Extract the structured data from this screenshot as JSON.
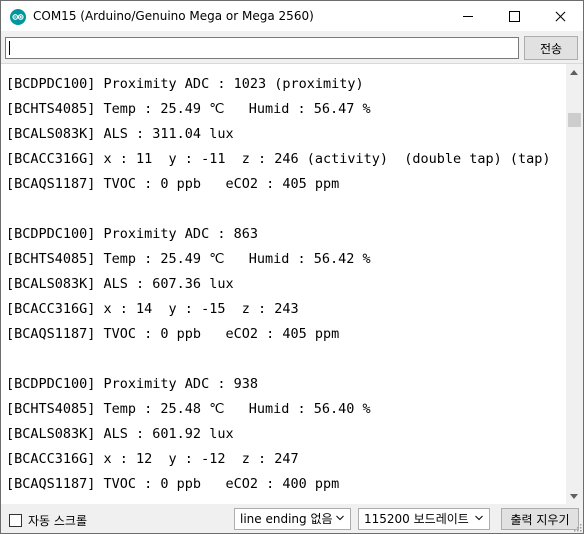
{
  "window": {
    "title": "COM15 (Arduino/Genuino Mega or Mega 2560)"
  },
  "input": {
    "value": "",
    "placeholder": "",
    "send_label": "전송"
  },
  "output": {
    "lines": [
      "[BCDPDC100] Proximity ADC : 1023 (proximity)",
      "[BCHTS4085] Temp : 25.49 ℃   Humid : 56.47 %",
      "[BCALS083K] ALS : 311.04 lux",
      "[BCACC316G] x : 11  y : -11  z : 246 (activity)  (double tap) (tap)",
      "[BCAQS1187] TVOC : 0 ppb   eCO2 : 405 ppm",
      "",
      "[BCDPDC100] Proximity ADC : 863",
      "[BCHTS4085] Temp : 25.49 ℃   Humid : 56.42 %",
      "[BCALS083K] ALS : 607.36 lux",
      "[BCACC316G] x : 14  y : -15  z : 243",
      "[BCAQS1187] TVOC : 0 ppb   eCO2 : 405 ppm",
      "",
      "[BCDPDC100] Proximity ADC : 938",
      "[BCHTS4085] Temp : 25.48 ℃   Humid : 56.40 %",
      "[BCALS083K] ALS : 601.92 lux",
      "[BCACC316G] x : 12  y : -12  z : 247",
      "[BCAQS1187] TVOC : 0 ppb   eCO2 : 400 ppm"
    ]
  },
  "bottom": {
    "autoscroll_label": "자동 스크롤",
    "autoscroll_checked": false,
    "line_ending": "line ending 없음",
    "baud_rate": "115200 보드레이트",
    "clear_label": "출력 지우기"
  },
  "colors": {
    "app_icon": "#00979c",
    "chrome_bg": "#f0f0f0",
    "button_bg": "#e1e1e1"
  }
}
